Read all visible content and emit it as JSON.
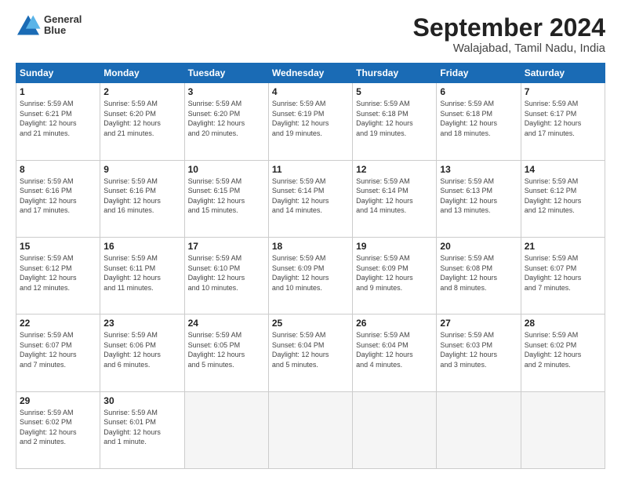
{
  "header": {
    "logo_line1": "General",
    "logo_line2": "Blue",
    "main_title": "September 2024",
    "sub_title": "Walajabad, Tamil Nadu, India"
  },
  "weekdays": [
    "Sunday",
    "Monday",
    "Tuesday",
    "Wednesday",
    "Thursday",
    "Friday",
    "Saturday"
  ],
  "weeks": [
    [
      {
        "day": "1",
        "info": "Sunrise: 5:59 AM\nSunset: 6:21 PM\nDaylight: 12 hours\nand 21 minutes."
      },
      {
        "day": "2",
        "info": "Sunrise: 5:59 AM\nSunset: 6:20 PM\nDaylight: 12 hours\nand 21 minutes."
      },
      {
        "day": "3",
        "info": "Sunrise: 5:59 AM\nSunset: 6:20 PM\nDaylight: 12 hours\nand 20 minutes."
      },
      {
        "day": "4",
        "info": "Sunrise: 5:59 AM\nSunset: 6:19 PM\nDaylight: 12 hours\nand 19 minutes."
      },
      {
        "day": "5",
        "info": "Sunrise: 5:59 AM\nSunset: 6:18 PM\nDaylight: 12 hours\nand 19 minutes."
      },
      {
        "day": "6",
        "info": "Sunrise: 5:59 AM\nSunset: 6:18 PM\nDaylight: 12 hours\nand 18 minutes."
      },
      {
        "day": "7",
        "info": "Sunrise: 5:59 AM\nSunset: 6:17 PM\nDaylight: 12 hours\nand 17 minutes."
      }
    ],
    [
      {
        "day": "8",
        "info": "Sunrise: 5:59 AM\nSunset: 6:16 PM\nDaylight: 12 hours\nand 17 minutes."
      },
      {
        "day": "9",
        "info": "Sunrise: 5:59 AM\nSunset: 6:16 PM\nDaylight: 12 hours\nand 16 minutes."
      },
      {
        "day": "10",
        "info": "Sunrise: 5:59 AM\nSunset: 6:15 PM\nDaylight: 12 hours\nand 15 minutes."
      },
      {
        "day": "11",
        "info": "Sunrise: 5:59 AM\nSunset: 6:14 PM\nDaylight: 12 hours\nand 14 minutes."
      },
      {
        "day": "12",
        "info": "Sunrise: 5:59 AM\nSunset: 6:14 PM\nDaylight: 12 hours\nand 14 minutes."
      },
      {
        "day": "13",
        "info": "Sunrise: 5:59 AM\nSunset: 6:13 PM\nDaylight: 12 hours\nand 13 minutes."
      },
      {
        "day": "14",
        "info": "Sunrise: 5:59 AM\nSunset: 6:12 PM\nDaylight: 12 hours\nand 12 minutes."
      }
    ],
    [
      {
        "day": "15",
        "info": "Sunrise: 5:59 AM\nSunset: 6:12 PM\nDaylight: 12 hours\nand 12 minutes."
      },
      {
        "day": "16",
        "info": "Sunrise: 5:59 AM\nSunset: 6:11 PM\nDaylight: 12 hours\nand 11 minutes."
      },
      {
        "day": "17",
        "info": "Sunrise: 5:59 AM\nSunset: 6:10 PM\nDaylight: 12 hours\nand 10 minutes."
      },
      {
        "day": "18",
        "info": "Sunrise: 5:59 AM\nSunset: 6:09 PM\nDaylight: 12 hours\nand 10 minutes."
      },
      {
        "day": "19",
        "info": "Sunrise: 5:59 AM\nSunset: 6:09 PM\nDaylight: 12 hours\nand 9 minutes."
      },
      {
        "day": "20",
        "info": "Sunrise: 5:59 AM\nSunset: 6:08 PM\nDaylight: 12 hours\nand 8 minutes."
      },
      {
        "day": "21",
        "info": "Sunrise: 5:59 AM\nSunset: 6:07 PM\nDaylight: 12 hours\nand 7 minutes."
      }
    ],
    [
      {
        "day": "22",
        "info": "Sunrise: 5:59 AM\nSunset: 6:07 PM\nDaylight: 12 hours\nand 7 minutes."
      },
      {
        "day": "23",
        "info": "Sunrise: 5:59 AM\nSunset: 6:06 PM\nDaylight: 12 hours\nand 6 minutes."
      },
      {
        "day": "24",
        "info": "Sunrise: 5:59 AM\nSunset: 6:05 PM\nDaylight: 12 hours\nand 5 minutes."
      },
      {
        "day": "25",
        "info": "Sunrise: 5:59 AM\nSunset: 6:04 PM\nDaylight: 12 hours\nand 5 minutes."
      },
      {
        "day": "26",
        "info": "Sunrise: 5:59 AM\nSunset: 6:04 PM\nDaylight: 12 hours\nand 4 minutes."
      },
      {
        "day": "27",
        "info": "Sunrise: 5:59 AM\nSunset: 6:03 PM\nDaylight: 12 hours\nand 3 minutes."
      },
      {
        "day": "28",
        "info": "Sunrise: 5:59 AM\nSunset: 6:02 PM\nDaylight: 12 hours\nand 2 minutes."
      }
    ],
    [
      {
        "day": "29",
        "info": "Sunrise: 5:59 AM\nSunset: 6:02 PM\nDaylight: 12 hours\nand 2 minutes."
      },
      {
        "day": "30",
        "info": "Sunrise: 5:59 AM\nSunset: 6:01 PM\nDaylight: 12 hours\nand 1 minute."
      },
      {
        "day": "",
        "info": ""
      },
      {
        "day": "",
        "info": ""
      },
      {
        "day": "",
        "info": ""
      },
      {
        "day": "",
        "info": ""
      },
      {
        "day": "",
        "info": ""
      }
    ]
  ]
}
